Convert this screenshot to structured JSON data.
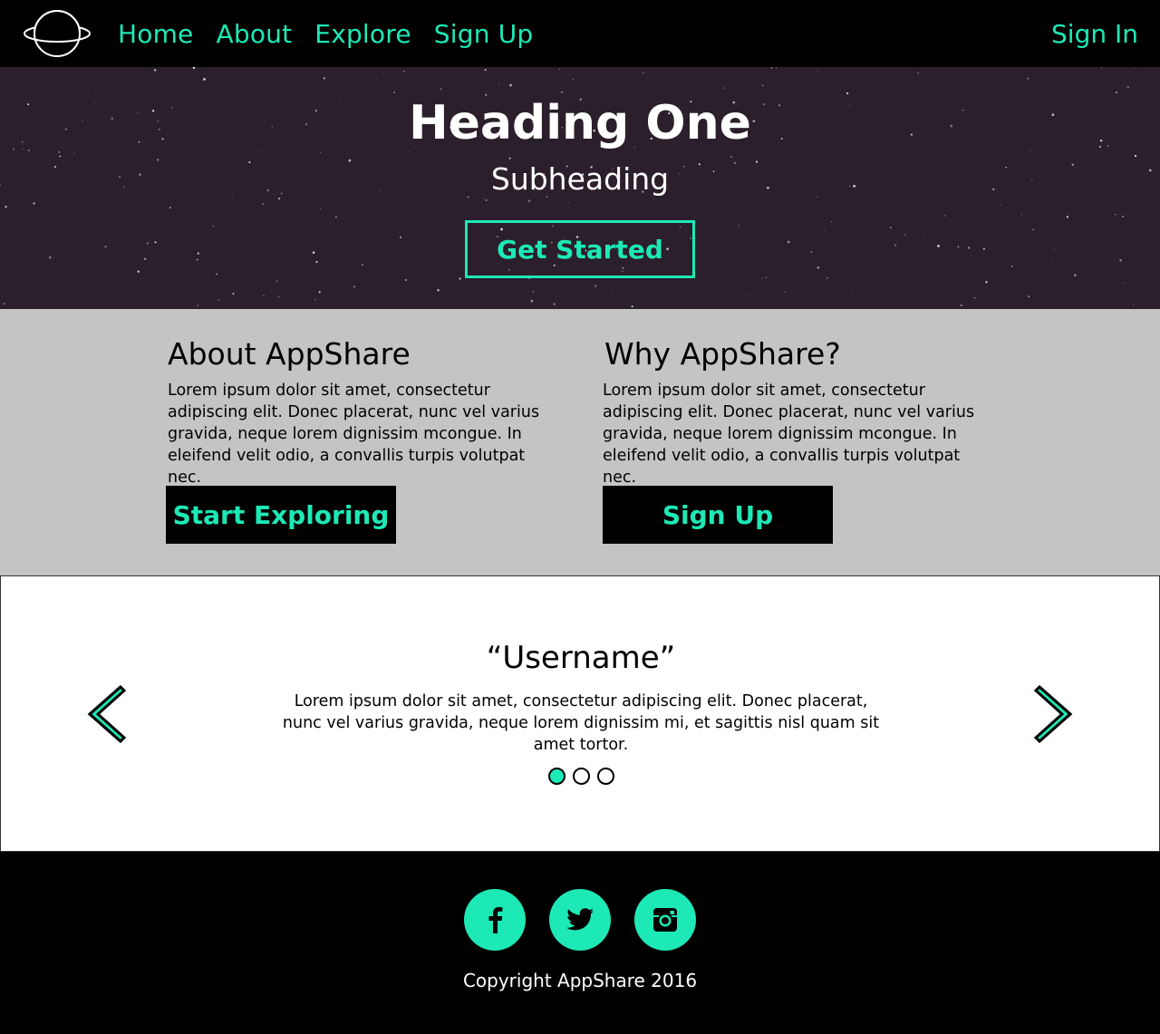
{
  "nav": {
    "links": [
      "Home",
      "About",
      "Explore",
      "Sign Up"
    ],
    "sign_in": "Sign In",
    "logo_icon": "planet-icon"
  },
  "hero": {
    "title": "Heading One",
    "subtitle": "Subheading",
    "cta": "Get Started"
  },
  "info": {
    "left": {
      "title": "About AppShare",
      "body": "Lorem ipsum dolor sit amet, consectetur adipiscing elit. Donec placerat, nunc vel varius gravida, neque lorem dignissim mcongue. In eleifend velit odio, a convallis turpis volutpat nec.",
      "button": "Start Exploring"
    },
    "right": {
      "title": "Why AppShare?",
      "body": "Lorem ipsum dolor sit amet, consectetur adipiscing elit. Donec placerat, nunc vel varius gravida, neque lorem dignissim mcongue. In eleifend velit odio, a convallis turpis volutpat nec.",
      "button": "Sign Up"
    }
  },
  "testimonial": {
    "name": "“Username”",
    "quote": "Lorem ipsum dolor sit amet, consectetur adipiscing elit. Donec placerat, nunc vel varius gravida, neque lorem dignissim mi, et sagittis nisl quam sit amet tortor.",
    "active_dot": 0,
    "dot_count": 3
  },
  "footer": {
    "socials": [
      "facebook-icon",
      "twitter-icon",
      "instagram-icon"
    ],
    "copyright": "Copyright AppShare 2016"
  },
  "colors": {
    "accent": "#1de9b6",
    "nav_bg": "#000000",
    "hero_bg": "#2b1f2c",
    "info_bg": "#c4c4c4"
  }
}
